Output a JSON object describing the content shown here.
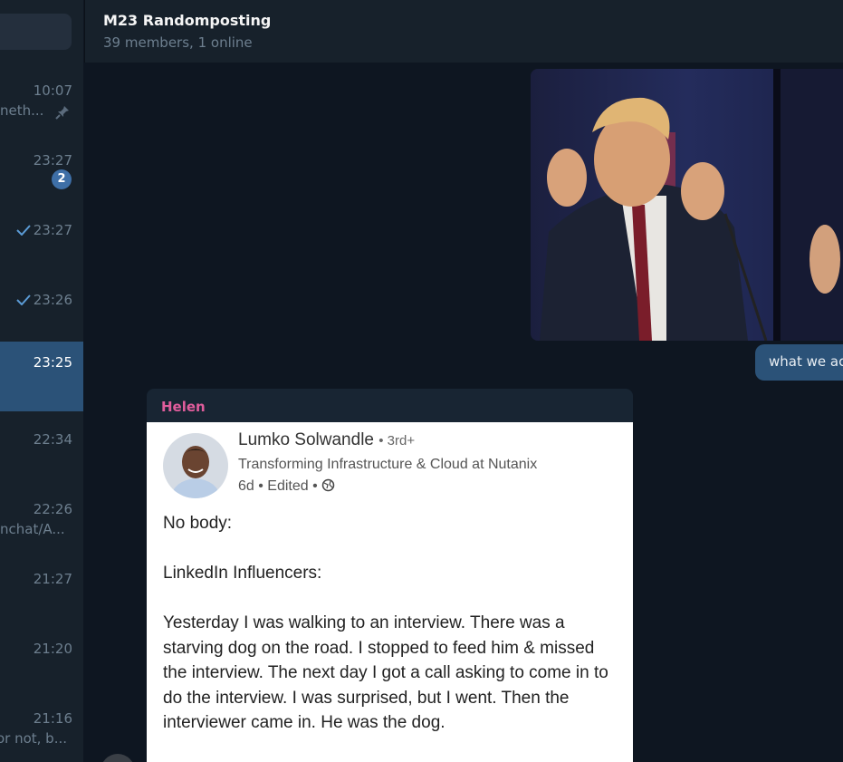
{
  "sidebar": {
    "chats": [
      {
        "time": "10:07",
        "preview": "neth...",
        "pinned": true
      },
      {
        "time": "23:27",
        "unread": "2"
      },
      {
        "time": "23:27",
        "read": true
      },
      {
        "time": "23:26",
        "read": true
      },
      {
        "time": "23:25",
        "active": true
      },
      {
        "time": "22:34"
      },
      {
        "time": "22:26",
        "preview": "nchat/A..."
      },
      {
        "time": "21:27"
      },
      {
        "time": "21:20"
      },
      {
        "time": "21:16",
        "preview": "or not, b..."
      }
    ]
  },
  "header": {
    "title": "M23 Randomposting",
    "status": "39 members, 1 online"
  },
  "messages": {
    "outgoing_text": "what we ac",
    "incoming": {
      "sender": "Helen",
      "screenshot": {
        "name": "Lumko Solwandle",
        "degree": "• 3rd+",
        "headline": "Transforming Infrastructure & Cloud at Nutanix",
        "meta": "6d • Edited •",
        "paragraphs": [
          "No body:",
          "LinkedIn Influencers:",
          "Yesterday I was walking to an interview. There was a starving dog on the road. I stopped to feed him & missed the interview. The next day I got a call asking to come in to do the interview. I was surprised, but I went. Then the interviewer came in. He was the dog."
        ]
      }
    }
  },
  "colors": {
    "accent": "#2b5278",
    "sender_name": "#e05d9c",
    "badge": "#3e6fa7"
  }
}
